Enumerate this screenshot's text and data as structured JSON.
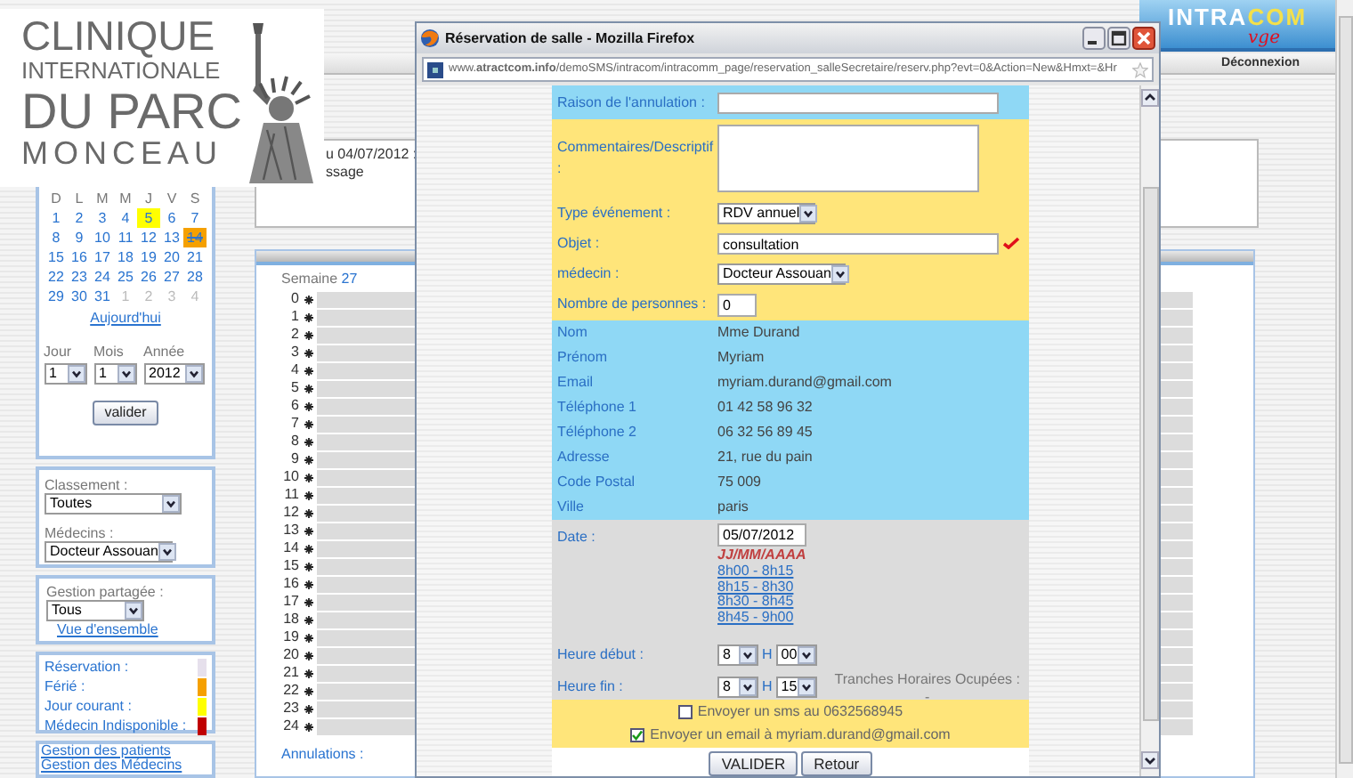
{
  "brand": {
    "word": "INTRA",
    "accent": "COM",
    "tagline": "vge"
  },
  "nav": {
    "items": [
      "Déconnexion"
    ]
  },
  "clinic_logo": {
    "lines": [
      "CLINIQUE",
      "INTERNATIONALE",
      "DU PARC",
      "MONCEAU"
    ]
  },
  "message": {
    "lines": [
      "u 04/07/2012 :",
      "ssage"
    ]
  },
  "calendar": {
    "weekdays": [
      "D",
      "L",
      "M",
      "M",
      "J",
      "V",
      "S"
    ],
    "weeks": [
      [
        {
          "day": "1",
          "kind": "normal"
        },
        {
          "day": "2",
          "kind": "normal"
        },
        {
          "day": "3",
          "kind": "normal"
        },
        {
          "day": "4",
          "kind": "normal"
        },
        {
          "day": "5",
          "kind": "current"
        },
        {
          "day": "6",
          "kind": "normal"
        },
        {
          "day": "7",
          "kind": "normal"
        }
      ],
      [
        {
          "day": "8",
          "kind": "normal"
        },
        {
          "day": "9",
          "kind": "normal"
        },
        {
          "day": "10",
          "kind": "normal"
        },
        {
          "day": "11",
          "kind": "normal"
        },
        {
          "day": "12",
          "kind": "normal"
        },
        {
          "day": "13",
          "kind": "normal"
        },
        {
          "day": "14",
          "kind": "holiday"
        }
      ],
      [
        {
          "day": "15",
          "kind": "normal"
        },
        {
          "day": "16",
          "kind": "normal"
        },
        {
          "day": "17",
          "kind": "normal"
        },
        {
          "day": "18",
          "kind": "normal"
        },
        {
          "day": "19",
          "kind": "normal"
        },
        {
          "day": "20",
          "kind": "normal"
        },
        {
          "day": "21",
          "kind": "normal"
        }
      ],
      [
        {
          "day": "22",
          "kind": "normal"
        },
        {
          "day": "23",
          "kind": "normal"
        },
        {
          "day": "24",
          "kind": "normal"
        },
        {
          "day": "25",
          "kind": "normal"
        },
        {
          "day": "26",
          "kind": "normal"
        },
        {
          "day": "27",
          "kind": "normal"
        },
        {
          "day": "28",
          "kind": "normal"
        }
      ],
      [
        {
          "day": "29",
          "kind": "normal"
        },
        {
          "day": "30",
          "kind": "normal"
        },
        {
          "day": "31",
          "kind": "normal"
        },
        {
          "day": "1",
          "kind": "other"
        },
        {
          "day": "2",
          "kind": "other"
        },
        {
          "day": "3",
          "kind": "other"
        },
        {
          "day": "4",
          "kind": "other"
        }
      ]
    ],
    "today_link": "Aujourd'hui",
    "selects": [
      {
        "label": "Jour",
        "value": "1"
      },
      {
        "label": "Mois",
        "value": "1"
      },
      {
        "label": "Année",
        "value": "2012"
      }
    ],
    "button": "valider"
  },
  "filters": [
    {
      "label": "Classement :",
      "value": "Toutes"
    },
    {
      "label": "Médecins :",
      "value": "Docteur Assouan"
    }
  ],
  "shared": {
    "label": "Gestion partagée :",
    "value": "Tous",
    "link": "Vue d'ensemble"
  },
  "legend": [
    {
      "label": "Réservation :",
      "color": "#e6e0ec"
    },
    {
      "label": "Férié :",
      "color": "#f5a000"
    },
    {
      "label": "Jour courant :",
      "color": "#ffff00"
    },
    {
      "label": "Médecin Indisponible :",
      "color": "#c00000"
    }
  ],
  "links": [
    "Gestion des patients",
    "Gestion des Médecins"
  ],
  "week": {
    "title": "Semaine",
    "number": "27",
    "hours": [
      "0",
      "1",
      "2",
      "3",
      "4",
      "5",
      "6",
      "7",
      "8",
      "9",
      "10",
      "11",
      "12",
      "13",
      "14",
      "15",
      "16",
      "17",
      "18",
      "19",
      "20",
      "21",
      "22",
      "23",
      "24"
    ],
    "footer": "Annulations :"
  },
  "popup": {
    "title": "Réservation de salle - Mozilla Firefox",
    "url": "www.**atractcom.info**/demoSMS/intracom/intracomm_page/reservation_salleSecretaire/reserv.php?evt=0&Action=New&Hmxt=&Hr",
    "cancel": {
      "label": "Raison de l'annulation :"
    },
    "event_rows": [
      {
        "kind": "textarea",
        "label": "Commentaires/Descriptif :"
      },
      {
        "kind": "select",
        "label": "Type événement :",
        "value": "RDV annuel"
      },
      {
        "kind": "input",
        "label": "Objet :",
        "value": "consultation",
        "valid": true
      },
      {
        "kind": "select",
        "label": "médecin :",
        "value": "Docteur Assouan"
      },
      {
        "kind": "number",
        "label": "Nombre de personnes :",
        "value": "0"
      }
    ],
    "patient": [
      {
        "label": "Nom",
        "value": "Mme Durand"
      },
      {
        "label": "Prénom",
        "value": "Myriam"
      },
      {
        "label": "Email",
        "value": "myriam.durand@gmail.com"
      },
      {
        "label": "Téléphone 1",
        "value": "01 42 58 96 32"
      },
      {
        "label": "Téléphone 2",
        "value": "06 32 56 89 45"
      },
      {
        "label": "Adresse",
        "value": "21, rue du pain"
      },
      {
        "label": "Code Postal",
        "value": "75 009"
      },
      {
        "label": "Ville",
        "value": "paris"
      }
    ],
    "date": {
      "label": "Date :",
      "value": "05/07/2012",
      "hint": "JJ/MM/AAAA",
      "slots": [
        "8h00 - 8h15",
        "8h15 - 8h30",
        "8h30 - 8h45",
        "8h45 - 9h00"
      ]
    },
    "start": {
      "label": "Heure début :",
      "hour": "8",
      "separator": "H",
      "minute": "00"
    },
    "end": {
      "label": "Heure fin :",
      "hour": "8",
      "separator": "H",
      "minute": "15"
    },
    "occupied": {
      "label": "Tranches Horaires Ocupées :",
      "value": "-"
    },
    "notifications": [
      {
        "label": "Envoyer un sms au 0632568945",
        "checked": false
      },
      {
        "label": "Envoyer un email à myriam.durand@gmail.com",
        "checked": true
      }
    ],
    "buttons": [
      "VALIDER",
      "Retour"
    ]
  }
}
